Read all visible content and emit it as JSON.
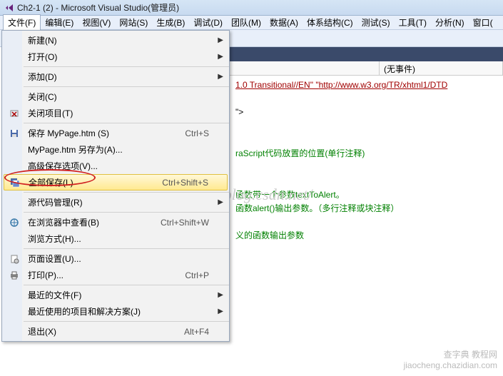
{
  "titlebar": {
    "title": "Ch2-1 (2) - Microsoft Visual Studio(管理员)"
  },
  "menubar": {
    "items": [
      {
        "label": "文件(F)",
        "active": true
      },
      {
        "label": "编辑(E)"
      },
      {
        "label": "视图(V)"
      },
      {
        "label": "网站(S)"
      },
      {
        "label": "生成(B)"
      },
      {
        "label": "调试(D)"
      },
      {
        "label": "团队(M)"
      },
      {
        "label": "数据(A)"
      },
      {
        "label": "体系结构(C)"
      },
      {
        "label": "测试(S)"
      },
      {
        "label": "工具(T)"
      },
      {
        "label": "分析(N)"
      },
      {
        "label": "窗口("
      }
    ]
  },
  "toolbar": {
    "icons": [
      "script",
      "comment",
      "div",
      "para",
      "break",
      "img",
      "link",
      "hr",
      "select",
      "input",
      "input2"
    ]
  },
  "file_menu": {
    "items": [
      {
        "label": "新建(N)",
        "shortcut": "",
        "arrow": true,
        "icon": null
      },
      {
        "label": "打开(O)",
        "shortcut": "",
        "arrow": true,
        "icon": null
      },
      {
        "sep": true
      },
      {
        "label": "添加(D)",
        "shortcut": "",
        "arrow": true,
        "icon": null
      },
      {
        "sep": true
      },
      {
        "label": "关闭(C)",
        "shortcut": "",
        "arrow": false,
        "icon": null
      },
      {
        "label": "关闭项目(T)",
        "shortcut": "",
        "arrow": false,
        "icon": "close-proj"
      },
      {
        "sep": true
      },
      {
        "label": "保存 MyPage.htm (S)",
        "shortcut": "Ctrl+S",
        "arrow": false,
        "icon": "save"
      },
      {
        "label": "MyPage.htm 另存为(A)...",
        "shortcut": "",
        "arrow": false,
        "icon": null
      },
      {
        "label": "高级保存选项(V)...",
        "shortcut": "",
        "arrow": false,
        "icon": null
      },
      {
        "label": "全部保存(L)",
        "shortcut": "Ctrl+Shift+S",
        "arrow": false,
        "icon": "save-all",
        "highlighted": true
      },
      {
        "sep": true
      },
      {
        "label": "源代码管理(R)",
        "shortcut": "",
        "arrow": true,
        "icon": null
      },
      {
        "sep": true
      },
      {
        "label": "在浏览器中查看(B)",
        "shortcut": "Ctrl+Shift+W",
        "arrow": false,
        "icon": "browse"
      },
      {
        "label": "浏览方式(H)...",
        "shortcut": "",
        "arrow": false,
        "icon": null
      },
      {
        "sep": true
      },
      {
        "label": "页面设置(U)...",
        "shortcut": "",
        "arrow": false,
        "icon": "page-setup"
      },
      {
        "label": "打印(P)...",
        "shortcut": "Ctrl+P",
        "arrow": false,
        "icon": "print"
      },
      {
        "sep": true
      },
      {
        "label": "最近的文件(F)",
        "shortcut": "",
        "arrow": true,
        "icon": null
      },
      {
        "label": "最近使用的项目和解决方案(J)",
        "shortcut": "",
        "arrow": true,
        "icon": null
      },
      {
        "sep": true
      },
      {
        "label": "退出(X)",
        "shortcut": "Alt+F4",
        "arrow": false,
        "icon": null
      }
    ]
  },
  "content": {
    "dropdown_event": "(无事件)",
    "code_lines": [
      {
        "text": "1.0 Transitional//EN\" \"",
        "class": "code-red",
        "suffix_text": "http://www.w3.org/TR/xhtml1/DTD",
        "suffix_class": "code-red"
      },
      {
        "text": "",
        "class": ""
      },
      {
        "text": "\">",
        "class": "code-black"
      },
      {
        "text": "",
        "class": ""
      },
      {
        "text": "",
        "class": ""
      },
      {
        "text": "raScript代码放置的位置(单行注释)",
        "class": "code-green"
      },
      {
        "text": "",
        "class": ""
      },
      {
        "text": "",
        "class": ""
      },
      {
        "text": "函数带一个参数textToAlert。",
        "class": "code-green"
      },
      {
        "text": "函数alert()输出参数。（多行注释或块注释）",
        "class": "code-green"
      },
      {
        "text": "",
        "class": ""
      },
      {
        "text": "义的函数输出参数",
        "class": "code-green"
      }
    ]
  },
  "watermark": {
    "text": "http://blog.csdn.net/",
    "footer1": "查字典 教程网",
    "footer2": "jiaocheng.chazidian.com"
  }
}
